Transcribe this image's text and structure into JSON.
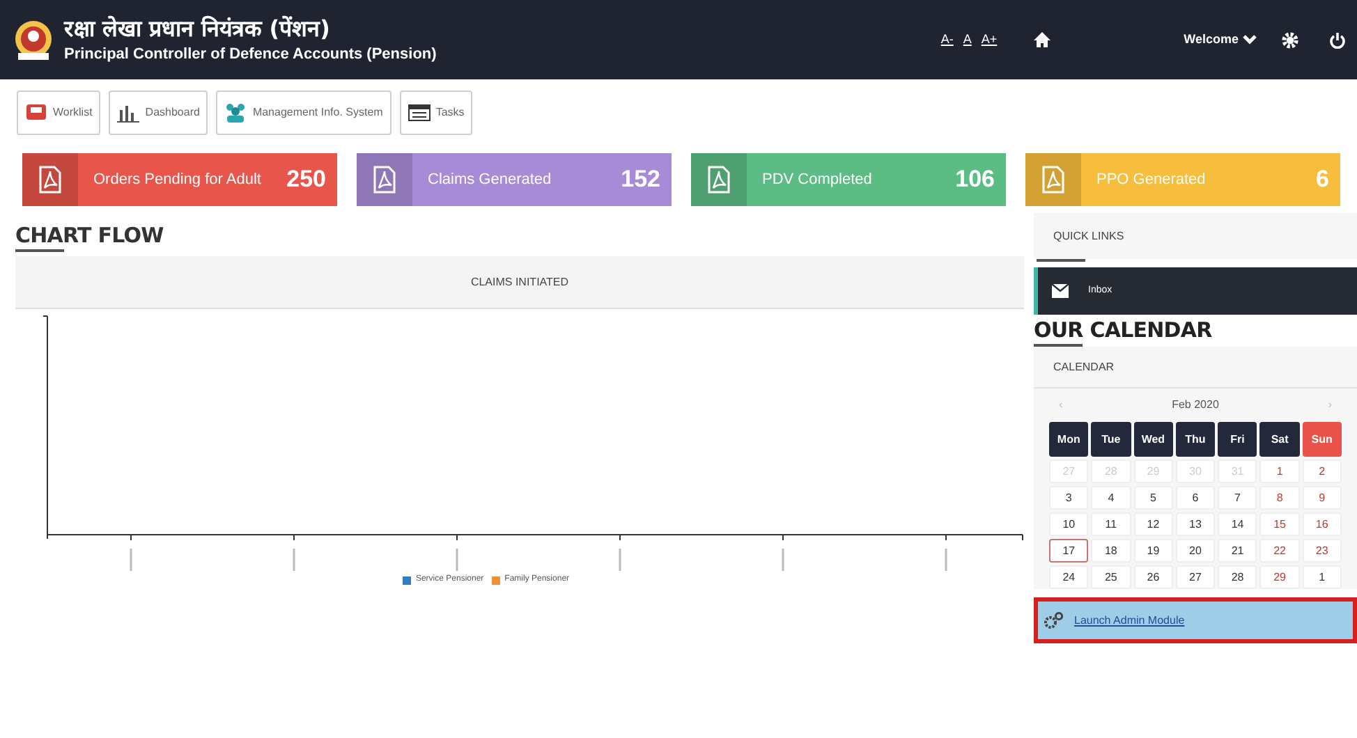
{
  "header": {
    "title_hindi": "रक्षा लेखा प्रधान नियंत्रक (पेंशन)",
    "title_english": "Principal Controller of Defence Accounts (Pension)",
    "font_controls": [
      "A-",
      "A",
      "A+"
    ],
    "welcome": "Welcome"
  },
  "toolbar": [
    {
      "label": "Worklist",
      "kind": "inbox"
    },
    {
      "label": "Dashboard",
      "kind": "chart"
    },
    {
      "label": "Management Info. System",
      "kind": "people"
    },
    {
      "label": "Tasks",
      "kind": "tasks"
    }
  ],
  "stats": [
    {
      "label": "Orders Pending for Adult",
      "value": "250",
      "color": "#e8554b"
    },
    {
      "label": "Claims Generated",
      "value": "152",
      "color": "#a88bd6"
    },
    {
      "label": "PDV Completed",
      "value": "106",
      "color": "#5cbd84"
    },
    {
      "label": "PPO Generated",
      "value": "6",
      "color": "#f7bd3d"
    }
  ],
  "chart_section": {
    "heading": "CHART FLOW",
    "panel_title": "CLAIMS INITIATED",
    "legend": [
      {
        "label": "Service Pensioner",
        "color": "#2f7fc1"
      },
      {
        "label": "Family Pensioner",
        "color": "#f0913a"
      }
    ]
  },
  "quick_links": {
    "title": "QUICK LINKS",
    "items": [
      {
        "label": "Inbox"
      }
    ]
  },
  "calendar": {
    "heading": "OUR CALENDAR",
    "panel_title": "CALENDAR",
    "prev": "‹",
    "month": "Feb 2020",
    "next": "›",
    "weekdays": [
      {
        "label": "Mon",
        "kind": "weekday"
      },
      {
        "label": "Tue",
        "kind": "weekday"
      },
      {
        "label": "Wed",
        "kind": "weekday"
      },
      {
        "label": "Thu",
        "kind": "weekday"
      },
      {
        "label": "Fri",
        "kind": "weekday"
      },
      {
        "label": "Sat",
        "kind": "weekday"
      },
      {
        "label": "Sun",
        "kind": "holiday"
      }
    ],
    "days": [
      {
        "label": "27",
        "kind": "muted",
        "selected": false
      },
      {
        "label": "28",
        "kind": "muted",
        "selected": false
      },
      {
        "label": "29",
        "kind": "muted",
        "selected": false
      },
      {
        "label": "30",
        "kind": "muted",
        "selected": false
      },
      {
        "label": "31",
        "kind": "muted",
        "selected": false
      },
      {
        "label": "1",
        "kind": "weekend",
        "selected": false
      },
      {
        "label": "2",
        "kind": "weekend",
        "selected": false
      },
      {
        "label": "3",
        "kind": "plain",
        "selected": false
      },
      {
        "label": "4",
        "kind": "plain",
        "selected": false
      },
      {
        "label": "5",
        "kind": "plain",
        "selected": false
      },
      {
        "label": "6",
        "kind": "plain",
        "selected": false
      },
      {
        "label": "7",
        "kind": "plain",
        "selected": false
      },
      {
        "label": "8",
        "kind": "weekend",
        "selected": false
      },
      {
        "label": "9",
        "kind": "weekend",
        "selected": false
      },
      {
        "label": "10",
        "kind": "plain",
        "selected": false
      },
      {
        "label": "11",
        "kind": "plain",
        "selected": false
      },
      {
        "label": "12",
        "kind": "plain",
        "selected": false
      },
      {
        "label": "13",
        "kind": "plain",
        "selected": false
      },
      {
        "label": "14",
        "kind": "plain",
        "selected": false
      },
      {
        "label": "15",
        "kind": "weekend",
        "selected": false
      },
      {
        "label": "16",
        "kind": "weekend",
        "selected": false
      },
      {
        "label": "17",
        "kind": "plain",
        "selected": true
      },
      {
        "label": "18",
        "kind": "plain",
        "selected": false
      },
      {
        "label": "19",
        "kind": "plain",
        "selected": false
      },
      {
        "label": "20",
        "kind": "plain",
        "selected": false
      },
      {
        "label": "21",
        "kind": "plain",
        "selected": false
      },
      {
        "label": "22",
        "kind": "weekend",
        "selected": false
      },
      {
        "label": "23",
        "kind": "weekend",
        "selected": false
      },
      {
        "label": "24",
        "kind": "plain",
        "selected": false
      },
      {
        "label": "25",
        "kind": "plain",
        "selected": false
      },
      {
        "label": "26",
        "kind": "plain",
        "selected": false
      },
      {
        "label": "27",
        "kind": "plain",
        "selected": false
      },
      {
        "label": "28",
        "kind": "plain",
        "selected": false
      },
      {
        "label": "29",
        "kind": "weekend",
        "selected": false
      },
      {
        "label": "1",
        "kind": "plain",
        "selected": false
      }
    ]
  },
  "admin_link": "Launch Admin Module"
}
